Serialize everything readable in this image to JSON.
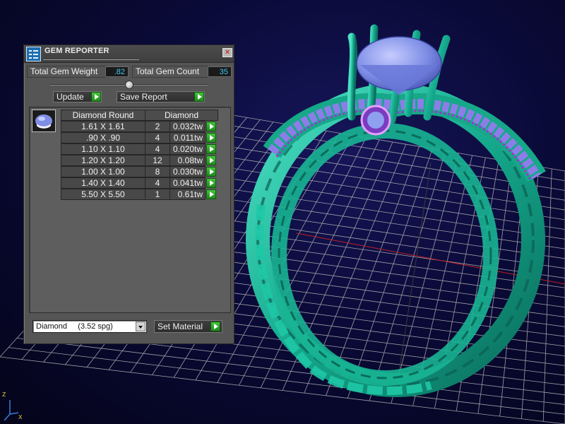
{
  "panel": {
    "title": "GEM REPORTER",
    "close_label": "×",
    "total_weight_label": "Total Gem Weight",
    "total_weight_value": ".82",
    "total_count_label": "Total Gem Count",
    "total_count_value": "35",
    "update_label": "Update",
    "save_report_label": "Save Report",
    "slider_position": 0.5
  },
  "table": {
    "headers": [
      "Diamond Round",
      "Diamond"
    ],
    "rows": [
      {
        "size": "1.61 X 1.61",
        "count": "2",
        "weight": "0.032tw"
      },
      {
        "size": ".90 X .90",
        "count": "4",
        "weight": "0.011tw"
      },
      {
        "size": "1.10 X 1.10",
        "count": "4",
        "weight": "0.020tw"
      },
      {
        "size": "1.20 X 1.20",
        "count": "12",
        "weight": "0.08tw"
      },
      {
        "size": "1.00 X 1.00",
        "count": "8",
        "weight": "0.030tw"
      },
      {
        "size": "1.40 X 1.40",
        "count": "4",
        "weight": "0.041tw"
      },
      {
        "size": "5.50 X 5.50",
        "count": "1",
        "weight": "0.61tw"
      }
    ]
  },
  "material": {
    "selected": "Diamond     (3.52 spg)",
    "set_material_label": "Set Material"
  },
  "viewport": {
    "axis_z_label": "z",
    "axis_x_label": "x"
  },
  "colors": {
    "panel_bg": "#555555",
    "value_text": "#3ec8f0",
    "accent_green": "#2fae2a",
    "ring_metal": "#19b597",
    "gem_blue": "#7f8fe6",
    "gem_purple": "#a233d6",
    "grid": "#b8b8b8"
  }
}
